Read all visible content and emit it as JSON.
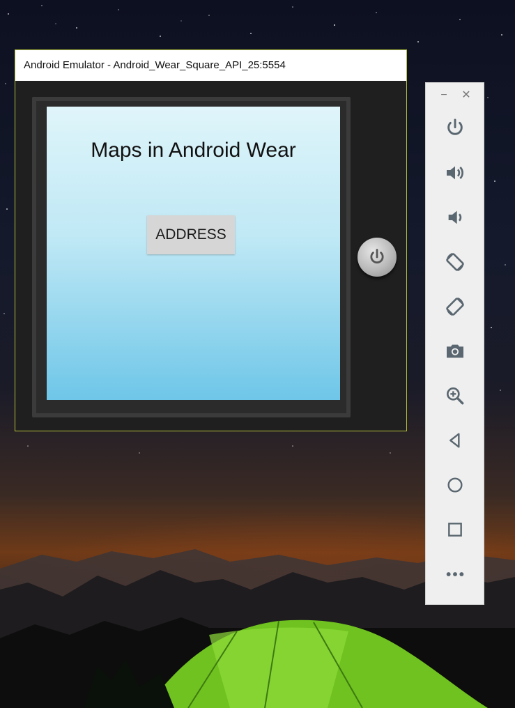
{
  "desktop": {
    "wallpaper": "night-sky-mountains-green-tent",
    "colors": {
      "tent": "#7fd12a",
      "horizon": "#d06a1e",
      "sky": "#121828"
    }
  },
  "emulator": {
    "title": "Android Emulator - Android_Wear_Square_API_25:5554",
    "border_color": "#b6c23a",
    "screen": {
      "app_title": "Maps in Android Wear",
      "address_button": "ADDRESS"
    },
    "hardware_button_icon": "power-icon"
  },
  "toolbar": {
    "minimize_glyph": "−",
    "close_glyph": "✕",
    "buttons": [
      "power-icon",
      "volume-up-icon",
      "volume-down-icon",
      "rotate-left-icon",
      "rotate-right-icon",
      "camera-icon",
      "zoom-icon",
      "back-icon",
      "home-icon",
      "overview-icon",
      "more-icon"
    ],
    "icon_color": "#5a6770"
  }
}
